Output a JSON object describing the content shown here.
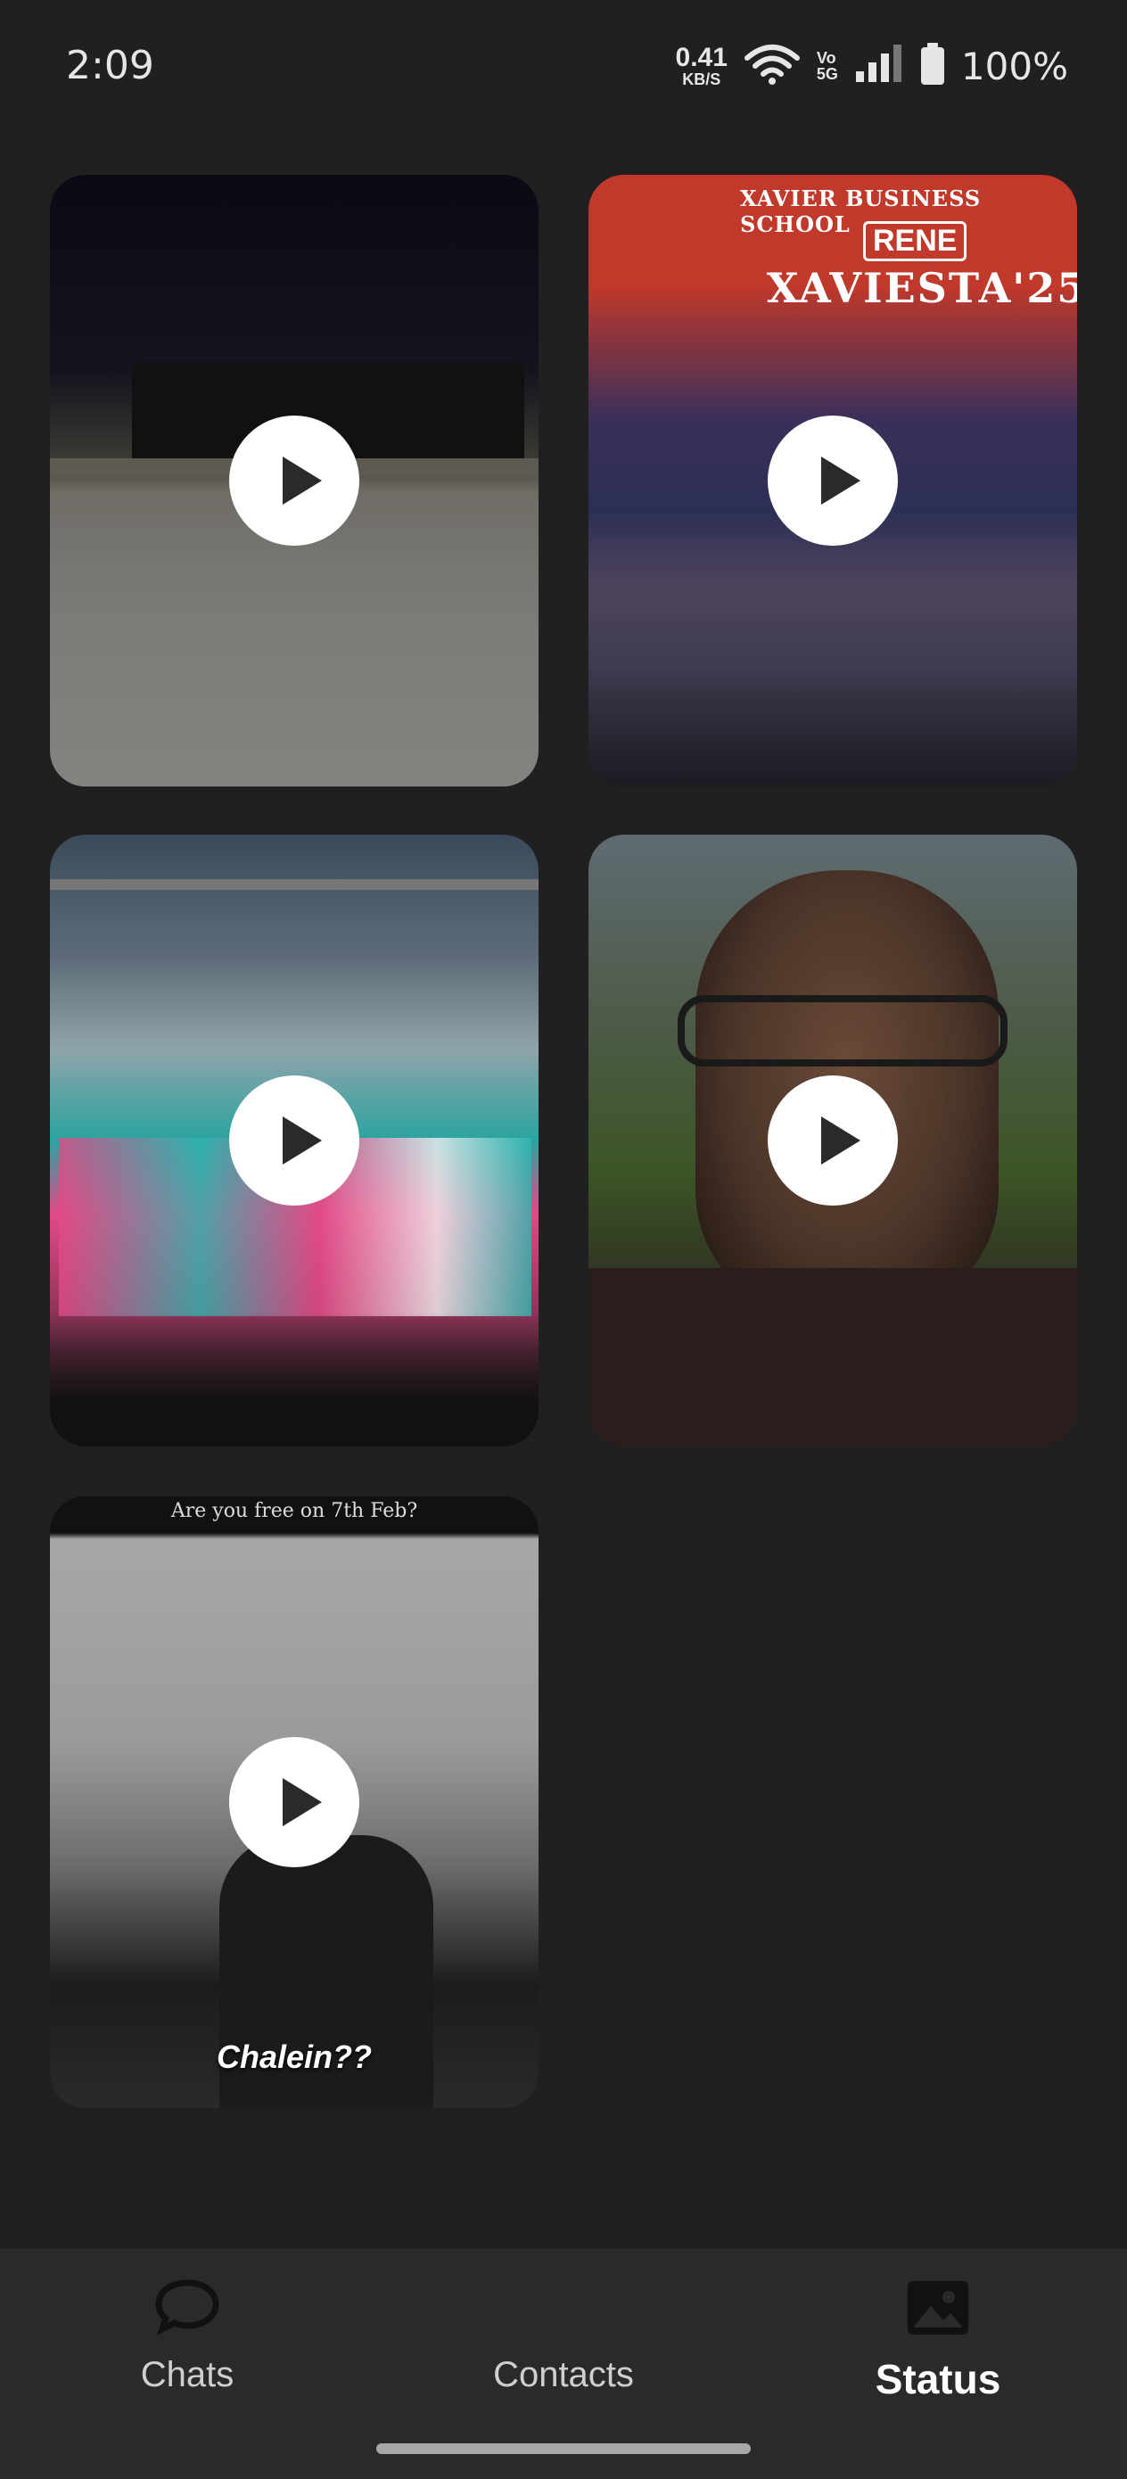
{
  "status_bar": {
    "time": "2:09",
    "net_speed": "0.41",
    "net_unit": "KB/S",
    "volte_top": "Vo",
    "volte_bottom": "5G",
    "battery": "100%",
    "icons": [
      "wifi-icon",
      "cell-signal-icon",
      "battery-icon"
    ]
  },
  "tiles": [
    {
      "type": "video",
      "icon": "play-icon"
    },
    {
      "type": "video",
      "icon": "play-icon",
      "poster_line": "XAVIER BUSINESS SCHOOL",
      "poster_brand": "RENE",
      "poster_title": "XAVIESTA'25"
    },
    {
      "type": "video",
      "icon": "play-icon"
    },
    {
      "type": "video",
      "icon": "play-icon"
    },
    {
      "type": "video",
      "icon": "play-icon",
      "top_caption": "Are you free on 7th Feb?",
      "caption": "Chalein??"
    }
  ],
  "nav": {
    "items": [
      {
        "label": "Chats",
        "icon": "chat-bubble-icon",
        "active": false
      },
      {
        "label": "Contacts",
        "icon": "contacts-icon",
        "active": false
      },
      {
        "label": "Status",
        "icon": "image-gallery-icon",
        "active": true
      }
    ]
  },
  "colors": {
    "background": "#202020",
    "nav_background": "#2a2a2a",
    "play_button": "#ffffff"
  }
}
